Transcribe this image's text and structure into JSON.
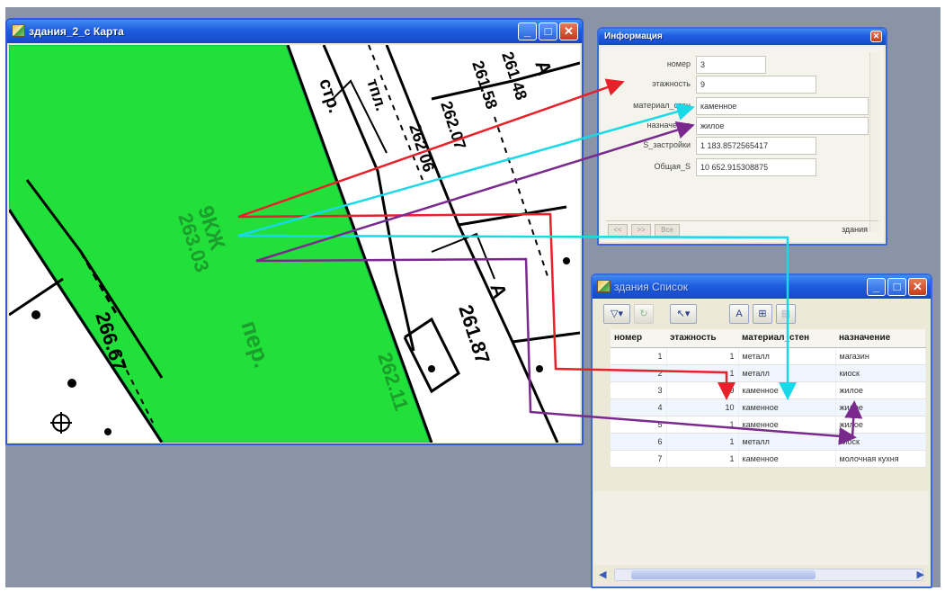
{
  "map_window": {
    "title": "здания_2_с Карта",
    "labels": {
      "zhil": "9КЖ",
      "elev1": "263.03",
      "per": "пер.",
      "elev2": "261.87",
      "elev3": "266.67",
      "elev4": "262.11",
      "litA1": "А",
      "litA2": "А",
      "top1": "261.48",
      "top2": "261.58",
      "top3": "262.07",
      "top4": "262.06",
      "strp": "стр.",
      "tpl": "тпл."
    },
    "colors": {
      "building": "#22e03a",
      "building_text": "#1b9e2c"
    }
  },
  "info_window": {
    "title": "Информация",
    "fields": [
      {
        "label": "номер",
        "value": "3"
      },
      {
        "label": "этажность",
        "value": "9"
      },
      {
        "label": "материал_стен",
        "value": "каменное"
      },
      {
        "label": "назначение",
        "value": "жилое"
      },
      {
        "label": "S_застройки",
        "value": "1 183.8572565417"
      },
      {
        "label": "Общая_S",
        "value": "10 652.915308875"
      }
    ],
    "nav": {
      "prev": "<<",
      "next": ">>",
      "all": "Все"
    },
    "footer_layer": "здания"
  },
  "list_window": {
    "title": "здания Список",
    "columns": [
      "номер",
      "этажность",
      "материал_стен",
      "назначение"
    ],
    "rows": [
      [
        "1",
        "1",
        "металл",
        "магазин"
      ],
      [
        "2",
        "1",
        "металл",
        "киоск"
      ],
      [
        "3",
        "9",
        "каменное",
        "жилое"
      ],
      [
        "4",
        "10",
        "каменное",
        "жилое"
      ],
      [
        "5",
        "1",
        "каменное",
        "жилое"
      ],
      [
        "6",
        "1",
        "металл",
        "киоск"
      ],
      [
        "7",
        "1",
        "каменное",
        "молочная кухня"
      ]
    ]
  },
  "arrow_colors": {
    "red": "#e8202a",
    "cyan": "#19d8e8",
    "purple": "#7a2a8f"
  }
}
